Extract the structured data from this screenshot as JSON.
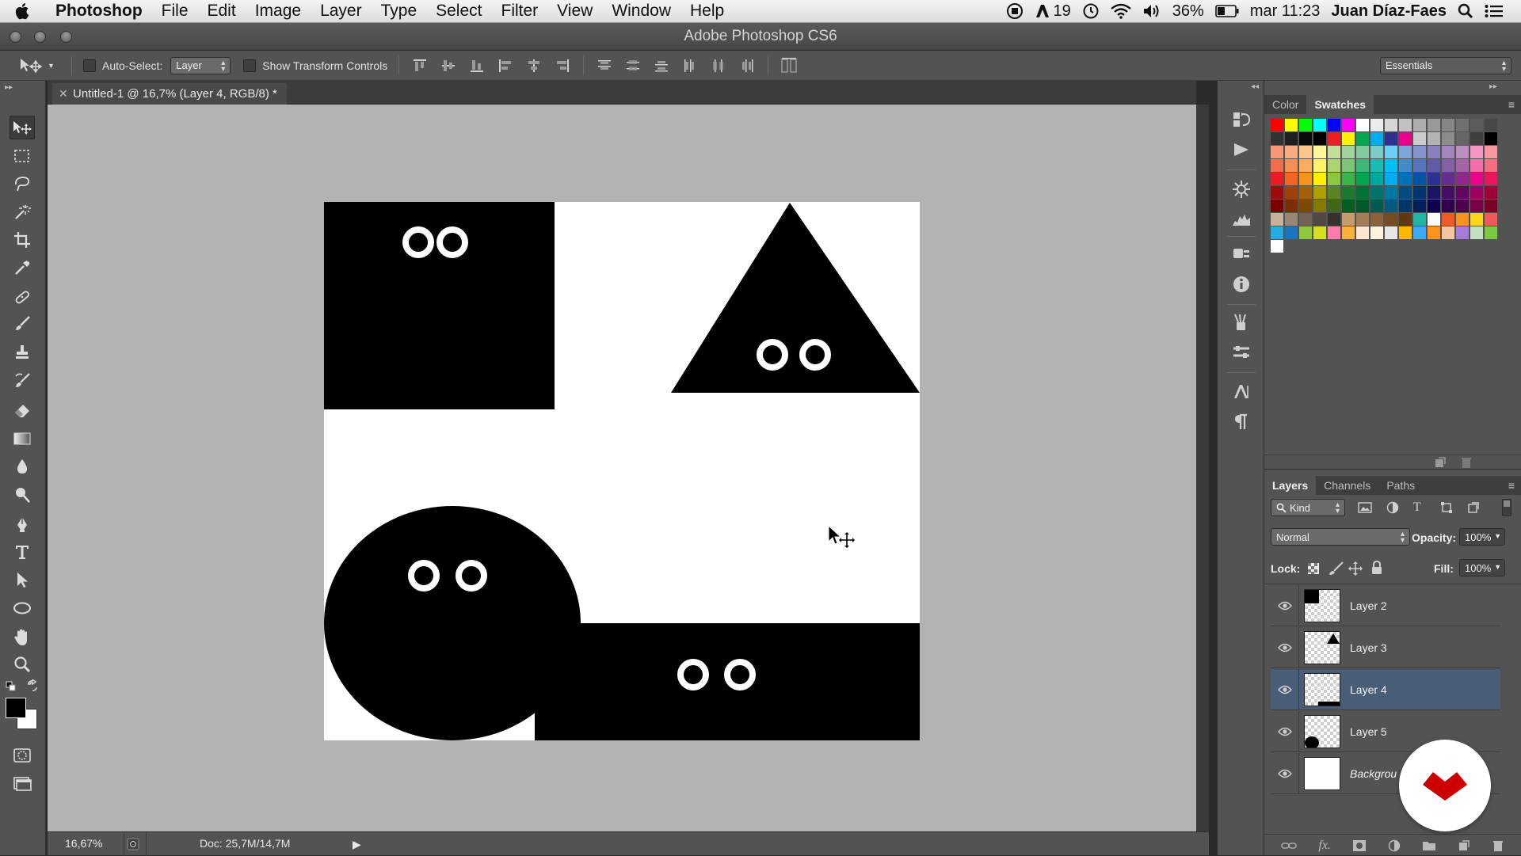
{
  "menubar": {
    "app": "Photoshop",
    "items": [
      "File",
      "Edit",
      "Image",
      "Layer",
      "Type",
      "Select",
      "Filter",
      "View",
      "Window",
      "Help"
    ],
    "status": {
      "adobe_count": "19",
      "battery": "36%",
      "clock": "mar 11:23",
      "user": "Juan Díaz-Faes"
    }
  },
  "window": {
    "title": "Adobe Photoshop CS6"
  },
  "options": {
    "auto_select_label": "Auto-Select:",
    "auto_select_value": "Layer",
    "transform_label": "Show Transform Controls",
    "workspace": "Essentials"
  },
  "document": {
    "tab": "Untitled-1 @ 16,7% (Layer 4, RGB/8) *",
    "zoom": "16,67%",
    "doc_size": "Doc: 25,7M/14,7M"
  },
  "color_panel": {
    "tabs": [
      "Color",
      "Swatches"
    ],
    "active_tab": "Swatches"
  },
  "layers_panel": {
    "tabs": [
      "Layers",
      "Channels",
      "Paths"
    ],
    "filter": "Kind",
    "blend_mode": "Normal",
    "opacity_label": "Opacity:",
    "opacity": "100%",
    "lock_label": "Lock:",
    "fill_label": "Fill:",
    "fill": "100%",
    "layers": [
      {
        "name": "Layer 2",
        "selected": false
      },
      {
        "name": "Layer 3",
        "selected": false
      },
      {
        "name": "Layer 4",
        "selected": true
      },
      {
        "name": "Layer 5",
        "selected": false
      },
      {
        "name": "Backgrou",
        "selected": false
      }
    ]
  },
  "colors": {
    "selected_layer": "#4a5d77",
    "panel": "#535353",
    "workspace": "#b3b3b3",
    "logo": "#cc0000"
  }
}
